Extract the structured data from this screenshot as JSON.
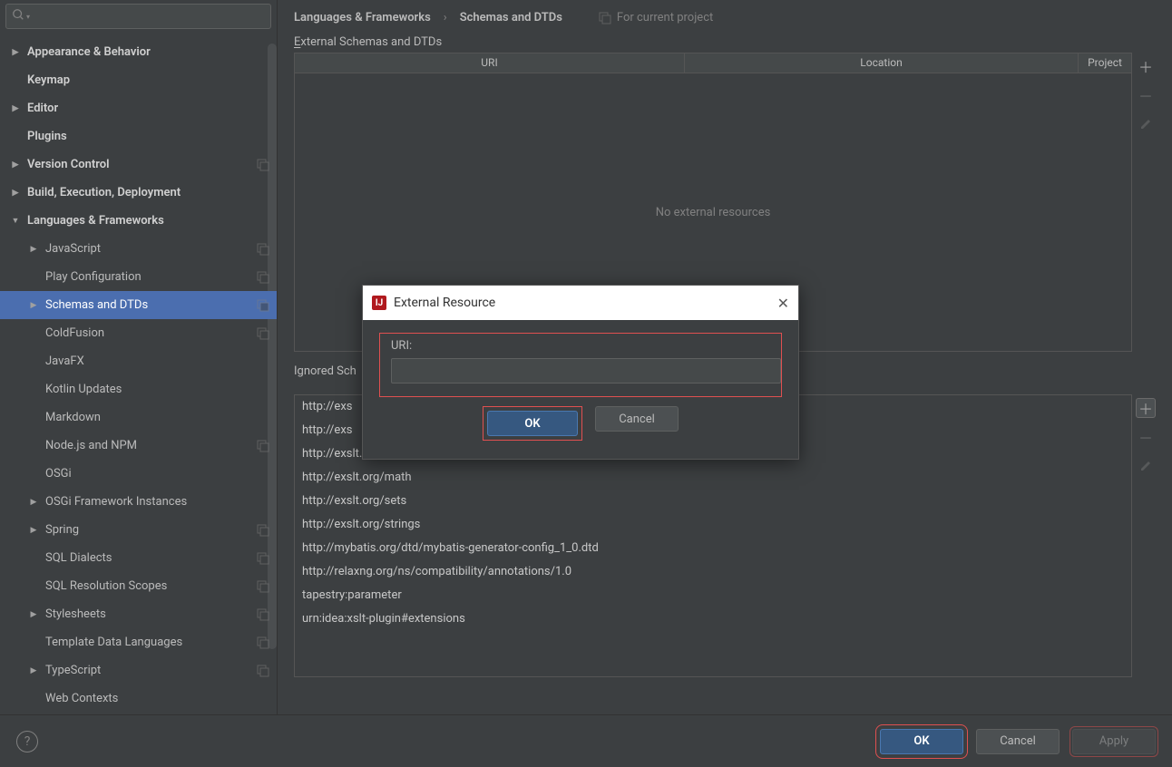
{
  "search": {
    "placeholder": ""
  },
  "sidebar": {
    "items": [
      {
        "label": "Appearance & Behavior",
        "level": 0,
        "arrow": "right",
        "bold": true,
        "copy": false
      },
      {
        "label": "Keymap",
        "level": 0,
        "arrow": "",
        "bold": true,
        "copy": false
      },
      {
        "label": "Editor",
        "level": 0,
        "arrow": "right",
        "bold": true,
        "copy": false
      },
      {
        "label": "Plugins",
        "level": 0,
        "arrow": "",
        "bold": true,
        "copy": false
      },
      {
        "label": "Version Control",
        "level": 0,
        "arrow": "right",
        "bold": true,
        "copy": true
      },
      {
        "label": "Build, Execution, Deployment",
        "level": 0,
        "arrow": "right",
        "bold": true,
        "copy": false
      },
      {
        "label": "Languages & Frameworks",
        "level": 0,
        "arrow": "down",
        "bold": true,
        "copy": false
      },
      {
        "label": "JavaScript",
        "level": 1,
        "arrow": "right",
        "bold": false,
        "copy": true
      },
      {
        "label": "Play Configuration",
        "level": 1,
        "arrow": "",
        "bold": false,
        "copy": true
      },
      {
        "label": "Schemas and DTDs",
        "level": 1,
        "arrow": "right",
        "bold": false,
        "copy": true,
        "selected": true
      },
      {
        "label": "ColdFusion",
        "level": 1,
        "arrow": "",
        "bold": false,
        "copy": true
      },
      {
        "label": "JavaFX",
        "level": 1,
        "arrow": "",
        "bold": false,
        "copy": false
      },
      {
        "label": "Kotlin Updates",
        "level": 1,
        "arrow": "",
        "bold": false,
        "copy": false
      },
      {
        "label": "Markdown",
        "level": 1,
        "arrow": "",
        "bold": false,
        "copy": false
      },
      {
        "label": "Node.js and NPM",
        "level": 1,
        "arrow": "",
        "bold": false,
        "copy": true
      },
      {
        "label": "OSGi",
        "level": 1,
        "arrow": "",
        "bold": false,
        "copy": false
      },
      {
        "label": "OSGi Framework Instances",
        "level": 1,
        "arrow": "right",
        "bold": false,
        "copy": false
      },
      {
        "label": "Spring",
        "level": 1,
        "arrow": "right",
        "bold": false,
        "copy": true
      },
      {
        "label": "SQL Dialects",
        "level": 1,
        "arrow": "",
        "bold": false,
        "copy": true
      },
      {
        "label": "SQL Resolution Scopes",
        "level": 1,
        "arrow": "",
        "bold": false,
        "copy": true
      },
      {
        "label": "Stylesheets",
        "level": 1,
        "arrow": "right",
        "bold": false,
        "copy": true
      },
      {
        "label": "Template Data Languages",
        "level": 1,
        "arrow": "",
        "bold": false,
        "copy": true
      },
      {
        "label": "TypeScript",
        "level": 1,
        "arrow": "right",
        "bold": false,
        "copy": true
      },
      {
        "label": "Web Contexts",
        "level": 1,
        "arrow": "",
        "bold": false,
        "copy": false
      }
    ]
  },
  "breadcrumb": {
    "part1": "Languages & Frameworks",
    "sep": "›",
    "part2": "Schemas and DTDs",
    "for_project": "For current project"
  },
  "sections": {
    "external_label_pre": "E",
    "external_label_rest": "xternal Schemas and DTDs",
    "ignored_label": "Ignored Sch"
  },
  "table": {
    "headers": {
      "uri": "URI",
      "location": "Location",
      "project": "Project"
    },
    "empty": "No external resources"
  },
  "ignored": [
    "http://exs",
    "http://exs",
    "http://exslt.org/dynamic",
    "http://exslt.org/math",
    "http://exslt.org/sets",
    "http://exslt.org/strings",
    "http://mybatis.org/dtd/mybatis-generator-config_1_0.dtd",
    "http://relaxng.org/ns/compatibility/annotations/1.0",
    "tapestry:parameter",
    "urn:idea:xslt-plugin#extensions"
  ],
  "dialog": {
    "title": "External Resource",
    "uri_label": "URI:",
    "ok": "OK",
    "cancel": "Cancel"
  },
  "footer": {
    "ok": "OK",
    "cancel": "Cancel",
    "apply": "Apply"
  }
}
